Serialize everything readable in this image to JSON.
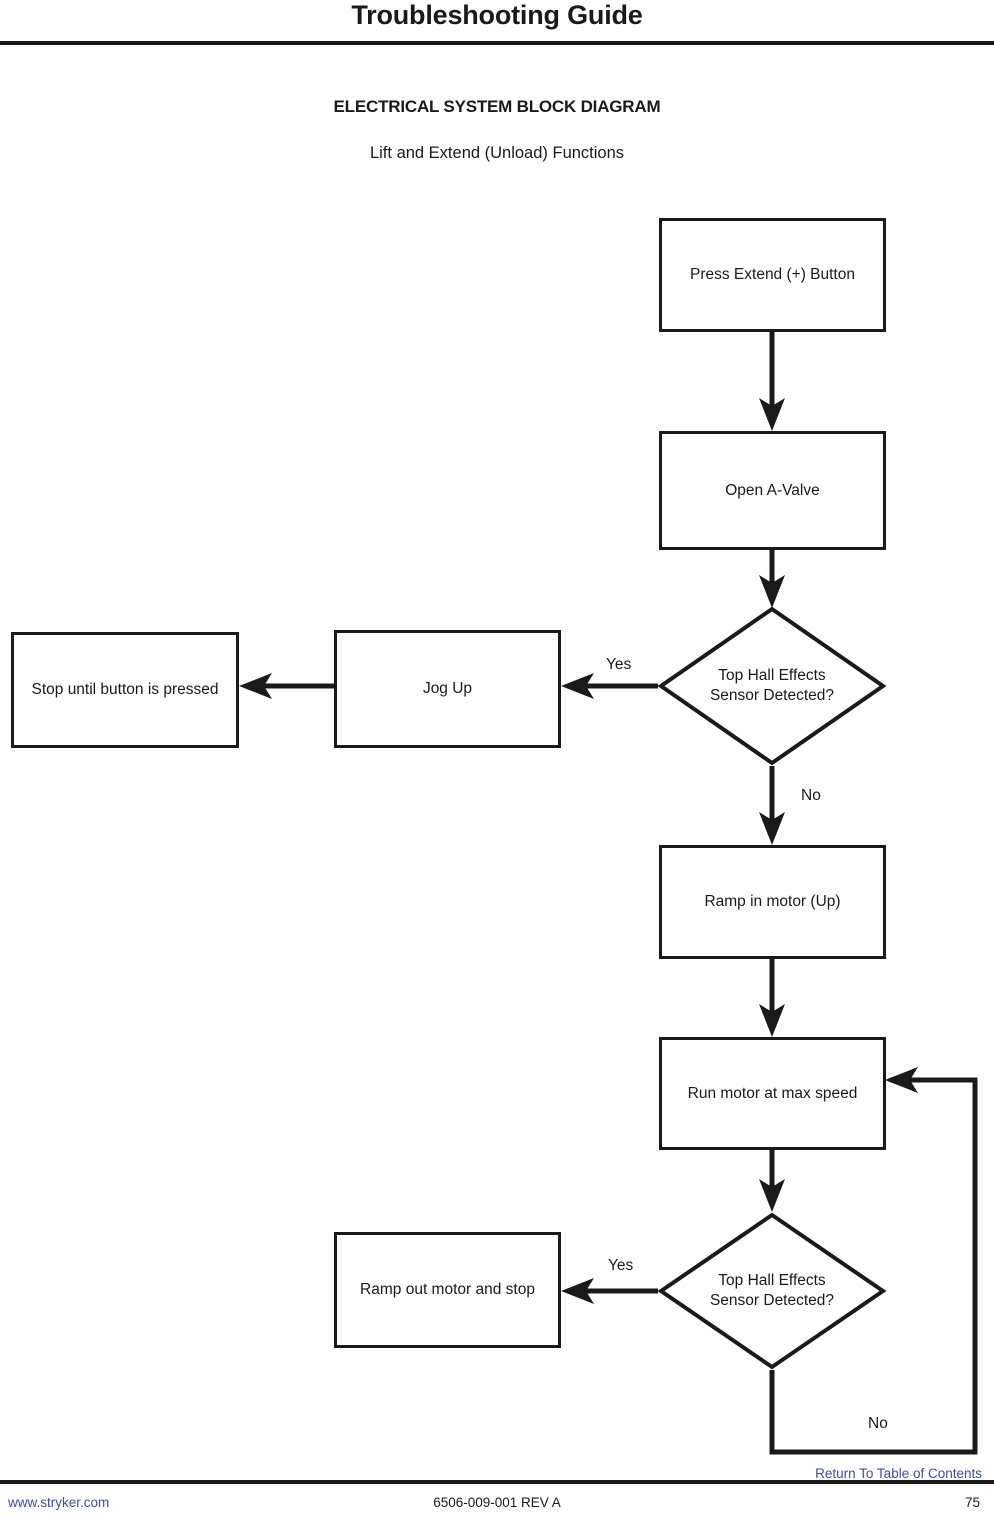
{
  "header": {
    "title": "Troubleshooting Guide"
  },
  "diagram": {
    "title": "ELECTRICAL SYSTEM BLOCK DIAGRAM",
    "subtitle": "Lift and Extend (Unload) Functions",
    "nodes": {
      "press_extend": "Press Extend (+) Button",
      "open_a_valve": "Open A-Valve",
      "decision_top": "Top Hall Effects\nSensor Detected?",
      "jog_up": "Jog Up",
      "stop_until_pressed": "Stop until button is pressed",
      "ramp_in_motor": "Ramp in motor (Up)",
      "run_motor_max": "Run motor at max speed",
      "decision_bottom": "Top Hall Effects\nSensor Detected?",
      "ramp_out_stop": "Ramp out motor and stop"
    },
    "edge_labels": {
      "yes_top": "Yes",
      "no_top": "No",
      "yes_bottom": "Yes",
      "no_bottom": "No"
    }
  },
  "footer": {
    "return_link": "Return To Table of Contents",
    "website": "www.stryker.com",
    "document_number": "6506-009-001 REV A",
    "page_number": "75"
  },
  "colors": {
    "ink": "#1a1a1a",
    "link": "#3b4fa0",
    "background": "#ffffff"
  }
}
